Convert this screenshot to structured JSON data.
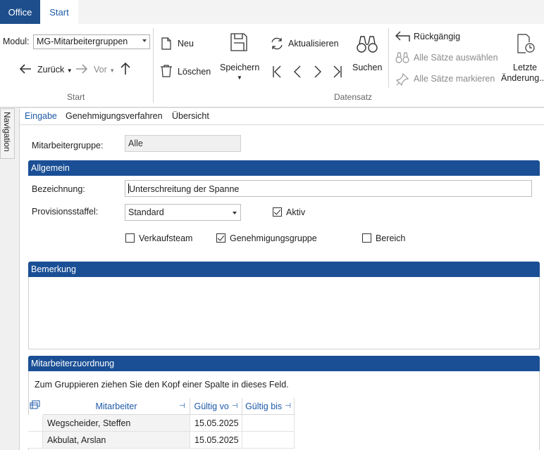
{
  "tabs": {
    "office": "Office",
    "start": "Start"
  },
  "ribbon": {
    "modul_label": "Modul:",
    "modul_value": "MG-Mitarbeitergruppen",
    "back_label": "Zurück",
    "forward_label": "Vor",
    "start_group": "Start",
    "neu": "Neu",
    "loeschen": "Löschen",
    "speichern": "Speichern",
    "aktualisieren": "Aktualisieren",
    "suchen": "Suchen",
    "datensatz_group": "Datensatz",
    "rueckgaengig": "Rückgängig",
    "alle_saetze_auswaehlen": "Alle Sätze auswählen",
    "alle_saetze_markieren": "Alle Sätze markieren",
    "letzte_line1": "Letzte",
    "letzte_line2": "Änderung..."
  },
  "navigation": "Navigation",
  "subtabs": [
    "Eingabe",
    "Genehmigungsverfahren",
    "Übersicht"
  ],
  "form": {
    "mitarbeitergruppe_label": "Mitarbeitergruppe:",
    "mitarbeitergruppe_value": "Alle",
    "allgemein": "Allgemein",
    "bezeichnung_label": "Bezeichnung:",
    "bezeichnung_value": "Unterschreitung der Spanne",
    "provisionsstaffel_label": "Provisionsstaffel:",
    "provisionsstaffel_value": "Standard",
    "aktiv_label": "Aktiv",
    "aktiv_checked": true,
    "verkaufsteam_label": "Verkaufsteam",
    "verkaufsteam_checked": false,
    "genehmigungsgruppe_label": "Genehmigungsgruppe",
    "genehmigungsgruppe_checked": true,
    "bereich_label": "Bereich",
    "bereich_checked": false,
    "bemerkung": "Bemerkung",
    "bemerkung_value": "",
    "mitarbeiterzuordnung": "Mitarbeiterzuordnung",
    "group_hint": "Zum Gruppieren ziehen Sie den Kopf einer Spalte in dieses Feld."
  },
  "grid": {
    "columns": [
      "Mitarbeiter",
      "Gültig vo",
      "Gültig bis"
    ],
    "rows": [
      {
        "mitarbeiter": "Wegscheider, Steffen",
        "gueltig_von": "15.05.2025",
        "gueltig_bis": ""
      },
      {
        "mitarbeiter": "Akbulat, Arslan",
        "gueltig_von": "15.05.2025",
        "gueltig_bis": ""
      }
    ]
  },
  "colors": {
    "accent": "#1a4f95",
    "office_tab": "#1e4e8c",
    "link": "#1e5aa8"
  }
}
